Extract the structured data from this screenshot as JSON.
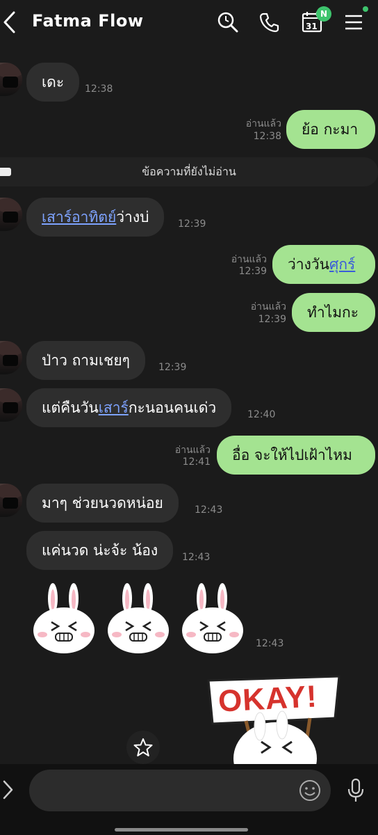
{
  "header": {
    "title": "Fatma Flow",
    "calendar_day": "31",
    "calendar_badge": "N"
  },
  "messages": [
    {
      "side": "left",
      "text": "เดะ",
      "time": "12:38"
    },
    {
      "side": "right",
      "read": "อ่านแล้ว",
      "text": "ย้อ กะมา",
      "time": "12:38"
    },
    {
      "side": "left",
      "link": "เสาร์อาทิตย์",
      "text_after": "ว่างบ่",
      "time": "12:39"
    },
    {
      "side": "right",
      "read": "อ่านแล้ว",
      "text_before": "ว่างวัน",
      "link": "ศุกร์",
      "time": "12:39"
    },
    {
      "side": "right",
      "read": "อ่านแล้ว",
      "text": "ทำไมกะ",
      "time": "12:39"
    },
    {
      "side": "left",
      "text": "ป่าว ถามเชยๆ",
      "time": "12:39"
    },
    {
      "side": "left",
      "text_before": "แต่คืนวัน",
      "link": "เสาร์",
      "text_after": "กะนอนคนเด่ว",
      "time": "12:40"
    },
    {
      "side": "right",
      "read": "อ่านแล้ว",
      "text": "อื่อ จะให้ไปเฝ้าไหม",
      "time": "12:41"
    },
    {
      "side": "left",
      "text": "มาๆ ช่วยนวดหน่อย",
      "time": "12:43"
    },
    {
      "side": "left",
      "text": "แค่นวด น่ะจ้ะ น้อง",
      "time": "12:43"
    },
    {
      "side": "left",
      "type": "stickers",
      "count": 3,
      "time": "12:43"
    },
    {
      "side": "right",
      "type": "sticker",
      "text": "OKAY!"
    }
  ],
  "unread_divider": "ข้อความที่ยังไม่อ่าน",
  "colors": {
    "background": "#1b1b1b",
    "left_bubble": "#2e2e2e",
    "right_bubble": "#a4e391",
    "link": "#7ea3ff",
    "badge": "#3ec46d",
    "sticker_text": "#d6332d"
  }
}
